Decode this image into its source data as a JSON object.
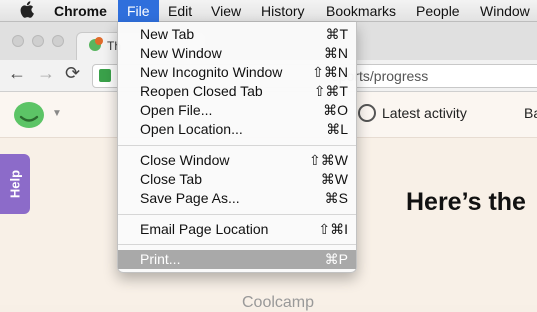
{
  "menubar": {
    "apple_icon": "apple-icon",
    "items": [
      "Chrome",
      "File",
      "Edit",
      "View",
      "History",
      "Bookmarks",
      "People",
      "Window"
    ]
  },
  "tab": {
    "title": "Th"
  },
  "toolbar": {
    "url": "eports/progress"
  },
  "app": {
    "activity_label": "Latest activity",
    "next_nav_label": "Ba",
    "help_label": "Help",
    "headline": "Here’s the",
    "footer_brand": "Coolcamp"
  },
  "file_menu": {
    "items": [
      {
        "label": "New Tab",
        "shortcut": "⌘T"
      },
      {
        "label": "New Window",
        "shortcut": "⌘N"
      },
      {
        "label": "New Incognito Window",
        "shortcut": "⇧⌘N"
      },
      {
        "label": "Reopen Closed Tab",
        "shortcut": "⇧⌘T"
      },
      {
        "label": "Open File...",
        "shortcut": "⌘O"
      },
      {
        "label": "Open Location...",
        "shortcut": "⌘L"
      },
      {
        "label": "Close Window",
        "shortcut": "⇧⌘W"
      },
      {
        "label": "Close Tab",
        "shortcut": "⌘W"
      },
      {
        "label": "Save Page As...",
        "shortcut": "⌘S"
      },
      {
        "label": "Email Page Location",
        "shortcut": "⇧⌘I"
      },
      {
        "label": "Print...",
        "shortcut": "⌘P"
      }
    ]
  },
  "colors": {
    "menu_highlight": "#2f6fdc",
    "selected_item": "#a9a9a9",
    "help_tab": "#8c6bc9",
    "logo": "#5cc466"
  }
}
